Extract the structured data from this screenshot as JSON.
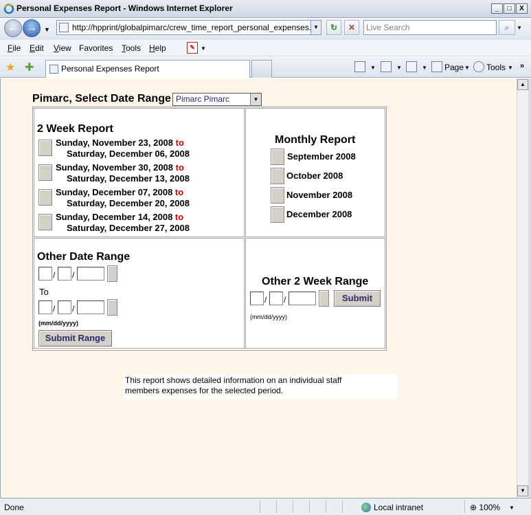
{
  "window": {
    "title": "Personal Expenses Report - Windows Internet Explorer",
    "min": "_",
    "max": "□",
    "close": "X"
  },
  "nav": {
    "address": "http://hpprint/globalpimarc/crew_time_report_personal_expenses.asp",
    "search_placeholder": "Live Search"
  },
  "menu": {
    "items": [
      {
        "key": "F",
        "rest": "ile"
      },
      {
        "key": "E",
        "rest": "dit"
      },
      {
        "key": "V",
        "rest": "iew"
      },
      {
        "key": "",
        "rest": "Favorites",
        "under": "F"
      },
      {
        "key": "T",
        "rest": "ools"
      },
      {
        "key": "H",
        "rest": "elp"
      }
    ]
  },
  "tabs": {
    "active_label": "Personal Expenses Report"
  },
  "commands": {
    "page": "Page",
    "tools": "Tools",
    "more": "»"
  },
  "report": {
    "select_label": "Pimarc, Select Date Range",
    "selected_user": "Pimarc Pimarc",
    "two_week": {
      "heading": "2 Week Report",
      "to_word": "to",
      "periods": [
        {
          "start": "Sunday, November 23, 2008",
          "end": "Saturday, December 06, 2008"
        },
        {
          "start": "Sunday, November 30, 2008",
          "end": "Saturday, December 13, 2008"
        },
        {
          "start": "Sunday, December 07, 2008",
          "end": "Saturday, December 20, 2008"
        },
        {
          "start": "Sunday, December 14, 2008",
          "end": "Saturday, December 27, 2008"
        }
      ]
    },
    "monthly": {
      "heading": "Monthly Report",
      "months": [
        "September  2008",
        "October  2008",
        "November  2008",
        "December  2008"
      ]
    },
    "other_range": {
      "heading": "Other Date Range",
      "to_label": "To",
      "format_hint": "(mm/dd/yyyy)",
      "submit_label": "Submit Range"
    },
    "other_two_week": {
      "heading": "Other 2 Week Range",
      "format_hint": "(mm/dd/yyyy)",
      "submit_label": "Submit"
    },
    "description_line1": "This report shows detailed information on an individual staff",
    "description_line2": "members expenses for the selected period."
  },
  "status": {
    "text": "Done",
    "zone": "Local intranet",
    "zoom": "100%"
  }
}
